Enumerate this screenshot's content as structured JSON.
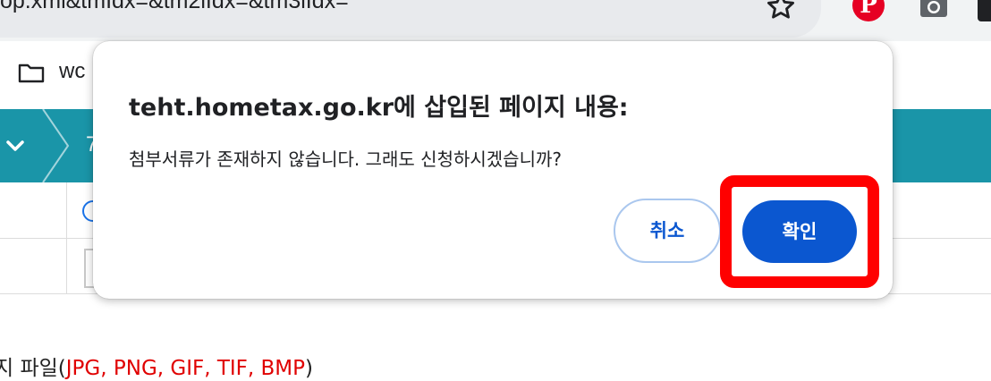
{
  "browser": {
    "url": "op.xml&tmIdx=&tm2lIdx=&tm3lIdx=",
    "bookmark_label": "wc"
  },
  "page": {
    "teal_fragment": "7",
    "file_note_prefix": "지 파일(",
    "file_note_types": "JPG, PNG, GIF, TIF, BMP",
    "file_note_suffix": ")"
  },
  "dialog": {
    "title": "teht.hometax.go.kr에 삽입된 페이지 내용:",
    "message": "첨부서류가 존재하지 않습니다. 그래도 신청하시겠습니까?",
    "cancel_label": "취소",
    "confirm_label": "확인"
  },
  "colors": {
    "primary_button": "#0b57d0",
    "highlight": "#ff0000",
    "teal_bar": "#1a95a8"
  },
  "icons": [
    "star-icon",
    "pinterest-icon",
    "camera-icon",
    "folder-icon",
    "chevron-down-icon",
    "chevron-right-icon"
  ]
}
